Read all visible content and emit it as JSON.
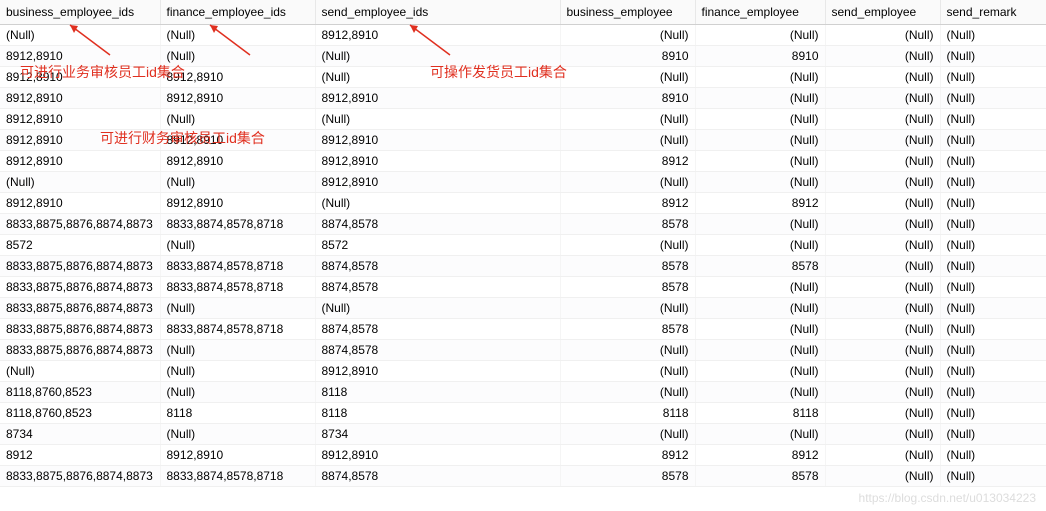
{
  "null_text": "(Null)",
  "columns": [
    "business_employee_ids",
    "finance_employee_ids",
    "send_employee_ids",
    "business_employee",
    "finance_employee",
    "send_employee",
    "send_remark"
  ],
  "annotations": {
    "a1": "可进行业务审核员工id集合",
    "a2": "可进行财务审核员工id集合",
    "a3": "可操作发货员工id集合"
  },
  "watermark": "https://blog.csdn.net/u013034223",
  "rows": [
    {
      "c1": null,
      "c2": null,
      "c3": "8912,8910",
      "c4": null,
      "c5": null,
      "c6": null,
      "c7": null
    },
    {
      "c1": "8912,8910",
      "c2": null,
      "c3": null,
      "c4": "8910",
      "c5": "8910",
      "c6": null,
      "c7": null
    },
    {
      "c1": "8912,8910",
      "c2": "8912,8910",
      "c3": null,
      "c4": null,
      "c5": null,
      "c6": null,
      "c7": null
    },
    {
      "c1": "8912,8910",
      "c2": "8912,8910",
      "c3": "8912,8910",
      "c4": "8910",
      "c5": null,
      "c6": null,
      "c7": null
    },
    {
      "c1": "8912,8910",
      "c2": null,
      "c3": null,
      "c4": null,
      "c5": null,
      "c6": null,
      "c7": null
    },
    {
      "c1": "8912,8910",
      "c2": "8912,8910",
      "c3": "8912,8910",
      "c4": null,
      "c5": null,
      "c6": null,
      "c7": null
    },
    {
      "c1": "8912,8910",
      "c2": "8912,8910",
      "c3": "8912,8910",
      "c4": "8912",
      "c5": null,
      "c6": null,
      "c7": null
    },
    {
      "c1": null,
      "c2": null,
      "c3": "8912,8910",
      "c4": null,
      "c5": null,
      "c6": null,
      "c7": null
    },
    {
      "c1": "8912,8910",
      "c2": "8912,8910",
      "c3": null,
      "c4": "8912",
      "c5": "8912",
      "c6": null,
      "c7": null
    },
    {
      "c1": "8833,8875,8876,8874,8873",
      "c2": "8833,8874,8578,8718",
      "c3": "8874,8578",
      "c4": "8578",
      "c5": null,
      "c6": null,
      "c7": null
    },
    {
      "c1": "8572",
      "c2": null,
      "c3": "8572",
      "c4": null,
      "c5": null,
      "c6": null,
      "c7": null
    },
    {
      "c1": "8833,8875,8876,8874,8873",
      "c2": "8833,8874,8578,8718",
      "c3": "8874,8578",
      "c4": "8578",
      "c5": "8578",
      "c6": null,
      "c7": null
    },
    {
      "c1": "8833,8875,8876,8874,8873",
      "c2": "8833,8874,8578,8718",
      "c3": "8874,8578",
      "c4": "8578",
      "c5": null,
      "c6": null,
      "c7": null
    },
    {
      "c1": "8833,8875,8876,8874,8873",
      "c2": null,
      "c3": null,
      "c4": null,
      "c5": null,
      "c6": null,
      "c7": null
    },
    {
      "c1": "8833,8875,8876,8874,8873",
      "c2": "8833,8874,8578,8718",
      "c3": "8874,8578",
      "c4": "8578",
      "c5": null,
      "c6": null,
      "c7": null
    },
    {
      "c1": "8833,8875,8876,8874,8873",
      "c2": null,
      "c3": "8874,8578",
      "c4": null,
      "c5": null,
      "c6": null,
      "c7": null
    },
    {
      "c1": null,
      "c2": null,
      "c3": "8912,8910",
      "c4": null,
      "c5": null,
      "c6": null,
      "c7": null
    },
    {
      "c1": "8118,8760,8523",
      "c2": null,
      "c3": "8118",
      "c4": null,
      "c5": null,
      "c6": null,
      "c7": null
    },
    {
      "c1": "8118,8760,8523",
      "c2": "8118",
      "c3": "8118",
      "c4": "8118",
      "c5": "8118",
      "c6": null,
      "c7": null
    },
    {
      "c1": "8734",
      "c2": null,
      "c3": "8734",
      "c4": null,
      "c5": null,
      "c6": null,
      "c7": null
    },
    {
      "c1": "8912",
      "c2": "8912,8910",
      "c3": "8912,8910",
      "c4": "8912",
      "c5": "8912",
      "c6": null,
      "c7": null
    },
    {
      "c1": "8833,8875,8876,8874,8873",
      "c2": "8833,8874,8578,8718",
      "c3": "8874,8578",
      "c4": "8578",
      "c5": "8578",
      "c6": null,
      "c7": null
    }
  ]
}
